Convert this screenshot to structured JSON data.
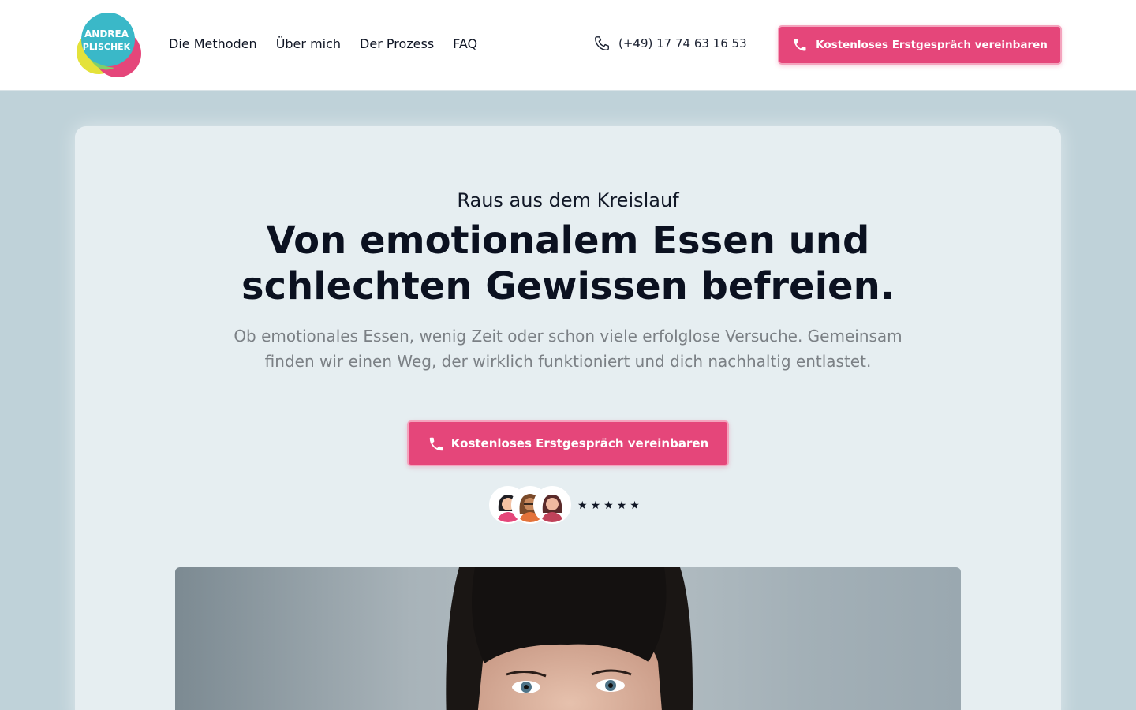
{
  "brand": {
    "logo_text_line1": "ANDREA",
    "logo_text_line2": "PLISCHEK",
    "colors": {
      "teal": "#3ab8c8",
      "yellow": "#e4e23a",
      "pink": "#e5467a",
      "green": "#7fcf6a"
    }
  },
  "nav": {
    "items": [
      {
        "label": "Die Methoden"
      },
      {
        "label": "Über mich"
      },
      {
        "label": "Der Prozess"
      },
      {
        "label": "FAQ"
      }
    ]
  },
  "header": {
    "phone_number": "(+49) 17 74 63 16 53",
    "phone_icon": "phone-outline-icon",
    "cta_label": "Kostenloses Erstgespräch vereinbaren",
    "cta_icon": "phone-filled-icon"
  },
  "hero": {
    "eyebrow": "Raus aus dem Kreislauf",
    "headline": "Von emotionalem Essen und schlechten Gewissen befreien.",
    "subtext": "Ob emotionales Essen, wenig Zeit oder schon viele erfolglose Versuche. Gemeinsam finden wir einen Weg, der wirklich funktioniert und dich nachhaltig entlastet.",
    "cta_label": "Kostenloses Erstgespräch vereinbaren",
    "rating_stars": 5,
    "star_glyph": "★",
    "accent_color": "#e5467a"
  }
}
